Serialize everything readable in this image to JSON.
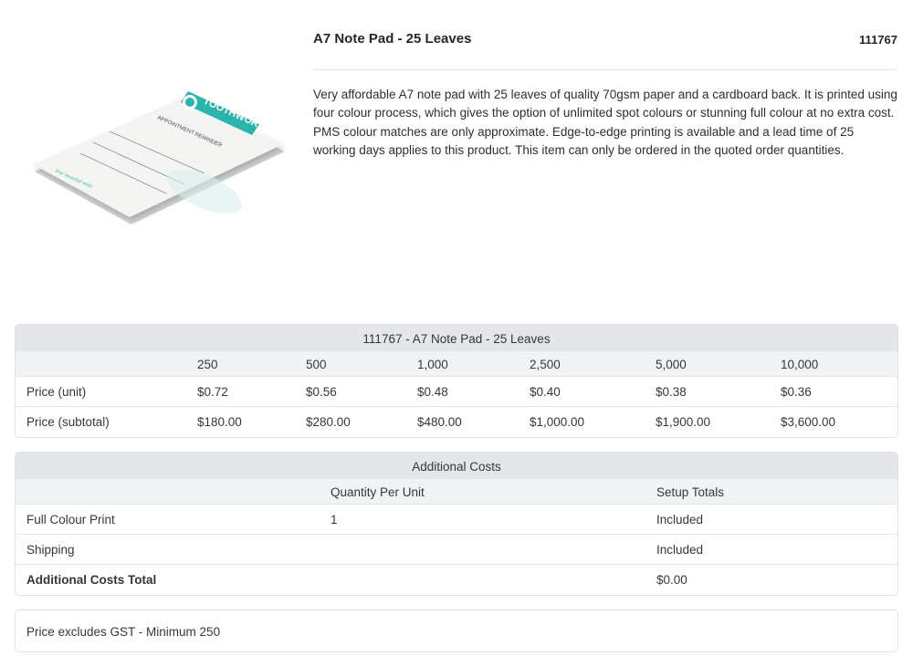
{
  "product": {
    "title": "A7 Note Pad - 25 Leaves",
    "code": "111767",
    "description": "Very affordable A7 note pad with 25 leaves of quality 70gsm paper and a cardboard back. It is printed using four colour process, which gives the option of unlimited spot colours or stunning full colour at no extra cost. PMS colour matches are only approximate. Edge-to-edge printing is available and a lead time of 25 working days applies to this product. This item can only be ordered in the quoted order quantities.",
    "image": {
      "brand": "TOOTHWORX",
      "heading": "APPOINTMENT REMINDER",
      "tagline": "Your beautiful smile"
    }
  },
  "pricing_table": {
    "title": "111767 - A7 Note Pad - 25 Leaves",
    "quantities": [
      "250",
      "500",
      "1,000",
      "2,500",
      "5,000",
      "10,000"
    ],
    "rows": [
      {
        "label": "Price (unit)",
        "values": [
          "$0.72",
          "$0.56",
          "$0.48",
          "$0.40",
          "$0.38",
          "$0.36"
        ]
      },
      {
        "label": "Price (subtotal)",
        "values": [
          "$180.00",
          "$280.00",
          "$480.00",
          "$1,000.00",
          "$1,900.00",
          "$3,600.00"
        ]
      }
    ]
  },
  "additional_costs": {
    "title": "Additional Costs",
    "headers": [
      "Quantity Per Unit",
      "Setup Totals"
    ],
    "rows": [
      {
        "label": "Full Colour Print",
        "qty": "1",
        "total": "Included"
      },
      {
        "label": "Shipping",
        "qty": "",
        "total": "Included"
      },
      {
        "label": "Additional Costs Total",
        "qty": "",
        "total": "$0.00"
      }
    ]
  },
  "footer_note": "Price excludes GST - Minimum 250",
  "colors": {
    "brand_teal": "#2bb3ad",
    "header_bg": "#e4e6ea",
    "subheader_bg": "#f2f3f5",
    "border": "#dfe2e6"
  }
}
